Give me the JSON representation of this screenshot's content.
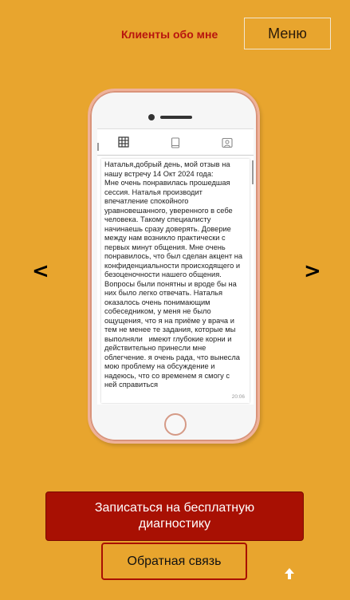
{
  "header": {
    "reviews_link": "Клиенты обо мне",
    "menu_label": "Меню"
  },
  "carousel": {
    "prev_label": "<",
    "next_label": ">"
  },
  "review": {
    "text": "Наталья,добрый день, мой отзыв на\nнашу встречу 14 Окт 2024 года:\nМне очень понравилась прошедшая\nсессия. Наталья производит\nвпечатление спокойного\nуравновешанного, уверенного в себе\nчеловека. Такому специалисту\nначинаешь сразу доверять. Доверие\nмежду нам возникло практически с\nпервых минут общения. Мне очень\nпонравилось, что был сделан акцент на\nконфиденциальности происходящего и\nбезоценочности нашего общения.\nВопросы были понятны и вроде бы на\nних было легко отвечать. Наталья\nоказалось очень понимающим\nсобеседником, у меня не было\nощущения, что я на приёме у врача и\nтем не менее те задания, которые мы\nвыполняли   имеют глубокие корни и\nдействительно принесли мне\nоблегчение. я очень рада, что вынесла\nмою проблему на обсуждение и\nнадеюсь, что со временем я смогу с\nней справиться",
    "time": "20:06"
  },
  "tabs": [
    {
      "icon": "grid-icon",
      "active": true
    },
    {
      "icon": "tablet-icon",
      "active": false
    },
    {
      "icon": "tagged-user-icon",
      "active": false
    }
  ],
  "cta": {
    "signup_label": "Записаться на бесплатную диагностику",
    "feedback_label": "Обратная связь"
  },
  "colors": {
    "background": "#e8a52e",
    "accent": "#a81003",
    "link": "#b8140f"
  }
}
